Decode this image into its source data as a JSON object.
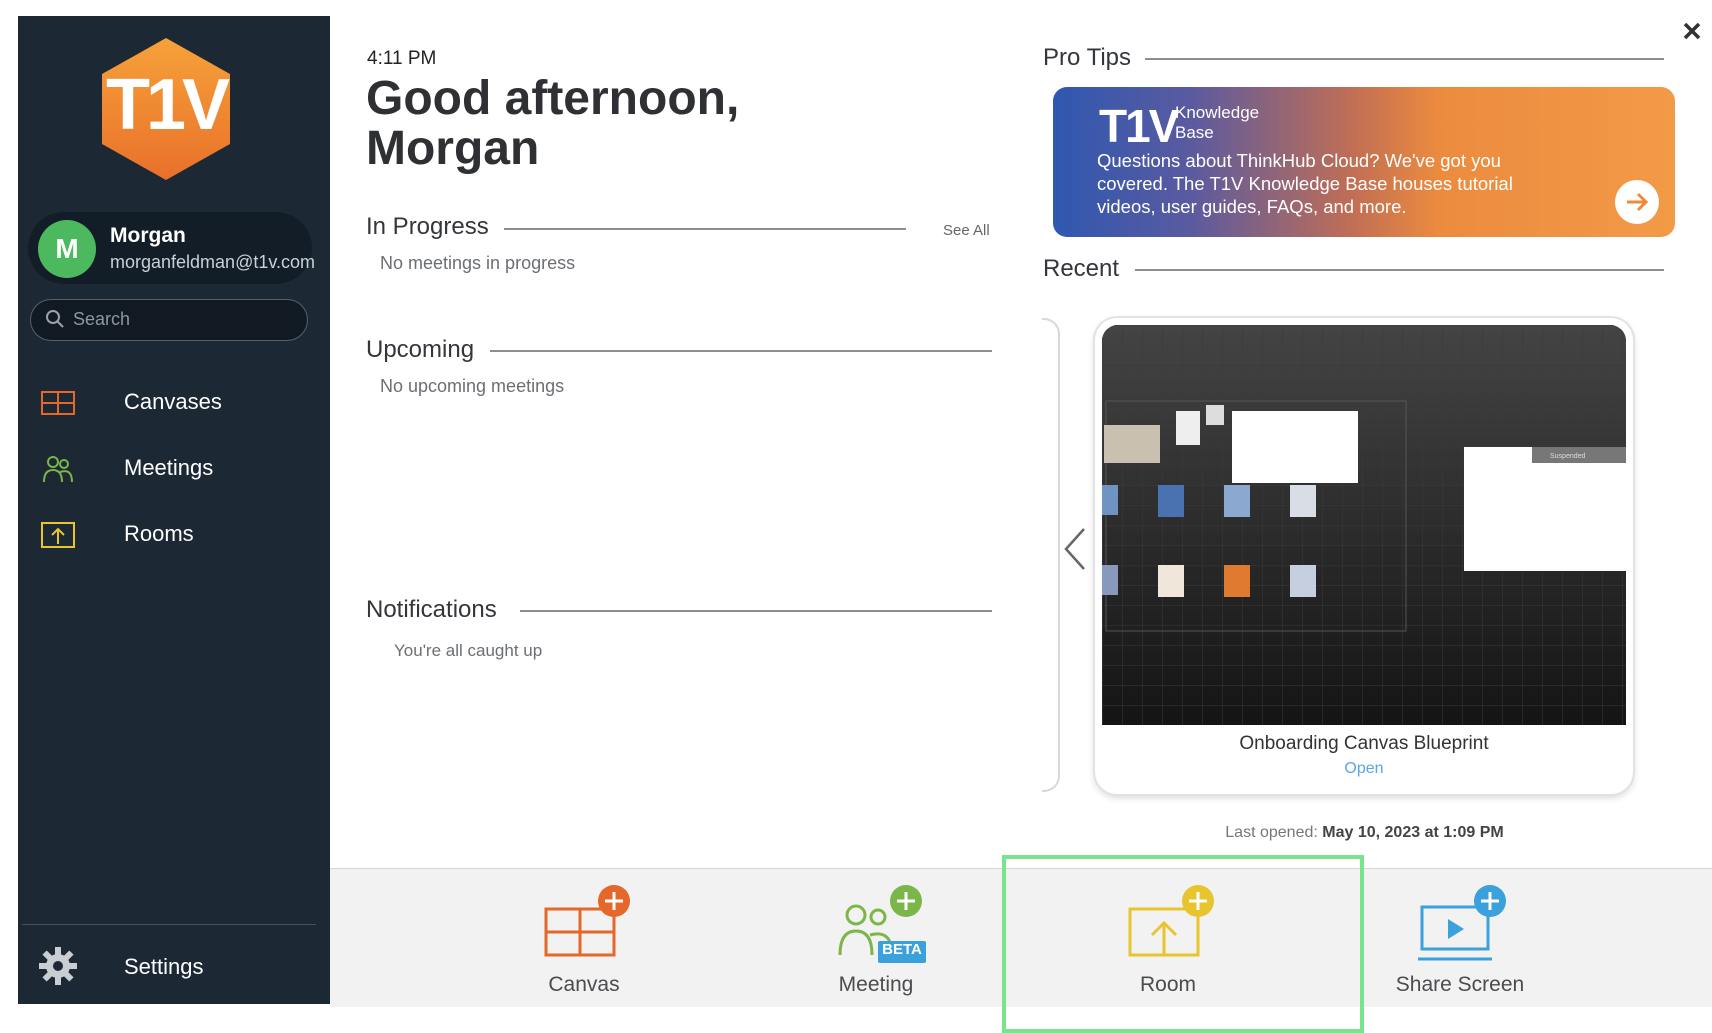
{
  "colors": {
    "sidebar_bg": "#1c2834",
    "avatar": "#4cb95f",
    "canvas_accent": "#e5672a",
    "meeting_accent": "#7ab648",
    "room_accent": "#e8c52e",
    "share_accent": "#3aa1dc",
    "highlight": "#7ae38e"
  },
  "sidebar": {
    "logo_text": "T1V",
    "user": {
      "initial": "M",
      "name": "Morgan",
      "email": "morganfeldman@t1v.com"
    },
    "search_placeholder": "Search",
    "nav": [
      {
        "label": "Canvases",
        "icon": "canvas-grid-icon"
      },
      {
        "label": "Meetings",
        "icon": "people-icon"
      },
      {
        "label": "Rooms",
        "icon": "room-upload-icon"
      }
    ],
    "settings_label": "Settings"
  },
  "main": {
    "time": "4:11 PM",
    "greeting_line1": "Good afternoon,",
    "greeting_line2": "Morgan",
    "in_progress": {
      "title": "In Progress",
      "see_all": "See All",
      "empty": "No meetings in progress"
    },
    "upcoming": {
      "title": "Upcoming",
      "empty": "No upcoming meetings"
    },
    "notifications": {
      "title": "Notifications",
      "empty": "You're all caught up"
    }
  },
  "right": {
    "pro_tips_title": "Pro Tips",
    "kb_banner": {
      "logo": "T1V",
      "logo_sub_line1": "Knowledge",
      "logo_sub_line2": "Base",
      "text": "Questions about ThinkHub Cloud? We've got you covered. The T1V Knowledge Base houses tutorial videos, user guides, FAQs, and more."
    },
    "recent_title": "Recent",
    "recent_item": {
      "name": "Onboarding Canvas Blueprint",
      "action": "Open",
      "thumb_badge": "Suspended",
      "last_opened_label": "Last opened:",
      "last_opened_value": "May 10, 2023 at 1:09 PM"
    }
  },
  "bottom_bar": {
    "actions": [
      {
        "label": "Canvas",
        "icon": "canvas-add-icon"
      },
      {
        "label": "Meeting",
        "icon": "meeting-add-icon",
        "badge": "BETA"
      },
      {
        "label": "Room",
        "icon": "room-add-icon",
        "highlighted": true
      },
      {
        "label": "Share Screen",
        "icon": "share-screen-add-icon"
      }
    ]
  }
}
